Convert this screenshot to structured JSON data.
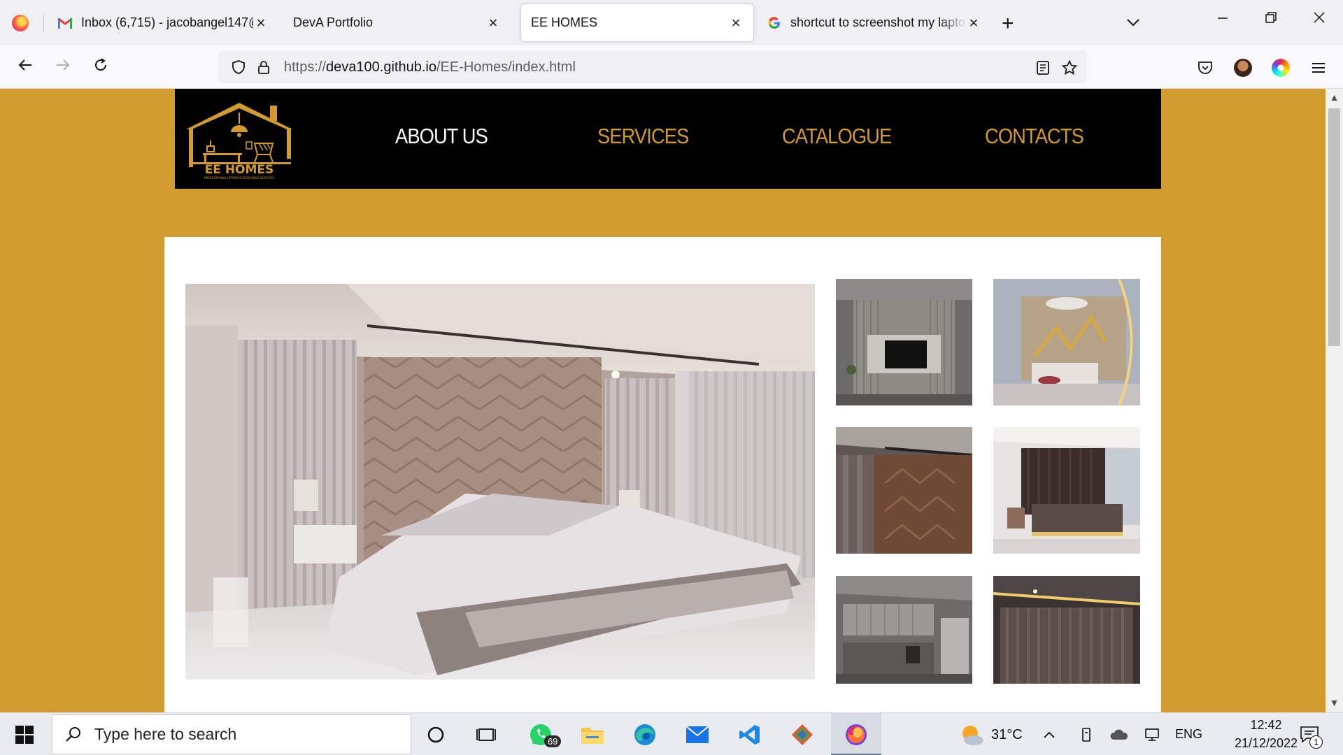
{
  "browser": {
    "tabs": [
      {
        "title": "Inbox (6,715) - jacobangel147@",
        "favicon": "gmail-icon",
        "active": false
      },
      {
        "title": "DevA Portfolio",
        "favicon": "none",
        "active": false
      },
      {
        "title": "EE HOMES",
        "favicon": "none",
        "active": true
      },
      {
        "title": "shortcut to screenshot my lapto",
        "favicon": "google-icon",
        "active": false
      }
    ],
    "url_prefix": "https://",
    "url_host": "deva100.github.io",
    "url_path": "/EE-Homes/index.html"
  },
  "site": {
    "brand_color": "#d19b2f",
    "logo_text": "EE HOMES",
    "logo_tagline": "PROFESSIONAL INTERIOR DESIGNING SERVICES",
    "nav": [
      {
        "label": "ABOUT US",
        "active": true
      },
      {
        "label": "SERVICES",
        "active": false
      },
      {
        "label": "CATALOGUE",
        "active": false
      },
      {
        "label": "CONTACTS",
        "active": false
      }
    ]
  },
  "taskbar": {
    "search_placeholder": "Type here to search",
    "whatsapp_badge": "69",
    "weather_temp": "31°C",
    "language": "ENG",
    "time": "12:42",
    "date": "21/12/2022",
    "notifications": "1"
  }
}
